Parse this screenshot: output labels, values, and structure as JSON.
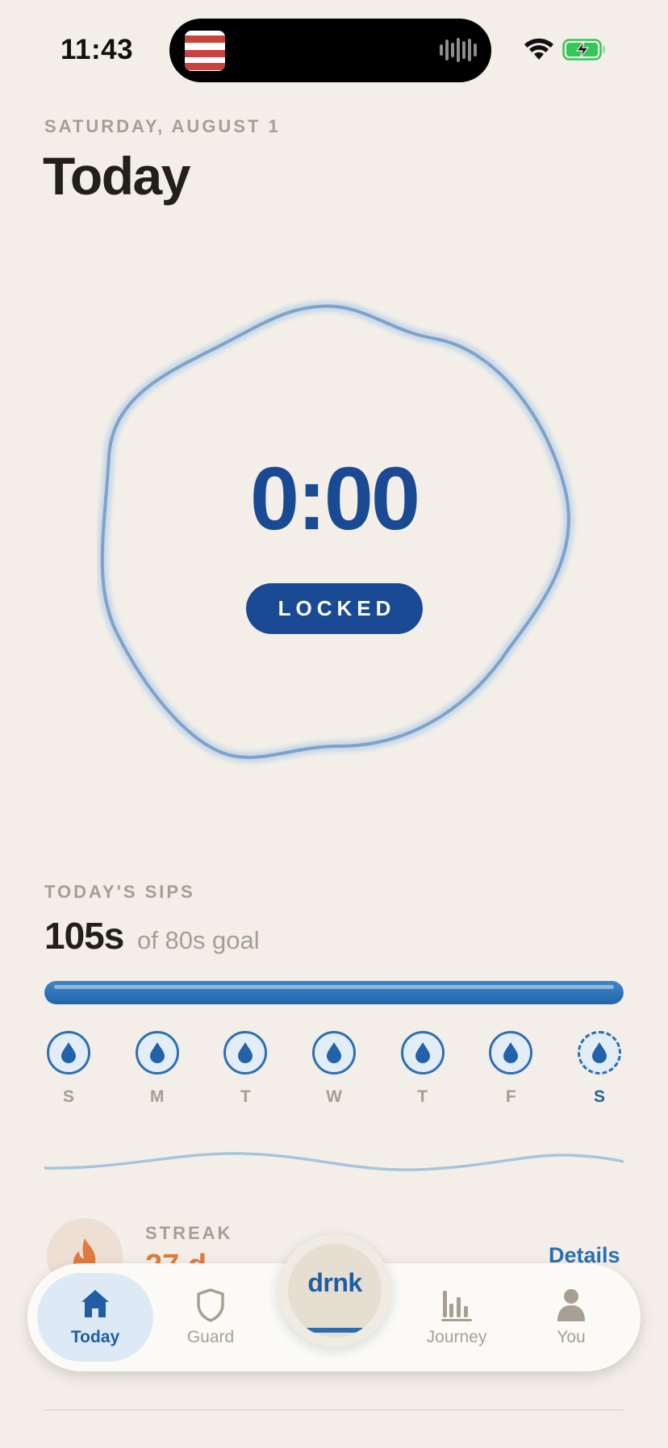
{
  "status_bar": {
    "time": "11:43",
    "icons": [
      "now-playing-art-icon",
      "audio-wave-icon",
      "wifi-icon",
      "battery-charging-icon"
    ]
  },
  "header": {
    "date": "SATURDAY, AUGUST 1",
    "title": "Today"
  },
  "timer": {
    "value": "0:00",
    "state_label": "LOCKED"
  },
  "sips": {
    "label": "TODAY'S SIPS",
    "value": "105s",
    "goal_text": "of 80s goal",
    "progress_fraction": 1.0,
    "days": [
      {
        "letter": "S",
        "today": false
      },
      {
        "letter": "M",
        "today": false
      },
      {
        "letter": "T",
        "today": false
      },
      {
        "letter": "W",
        "today": false
      },
      {
        "letter": "T",
        "today": false
      },
      {
        "letter": "F",
        "today": false
      },
      {
        "letter": "S",
        "today": true
      }
    ]
  },
  "streak": {
    "label": "STREAK",
    "value": "27 d",
    "details_label": "Details",
    "icon": "flame-icon"
  },
  "tab_bar": {
    "today": "Today",
    "guard": "Guard",
    "center_brand": "drnk",
    "journey": "Journey",
    "you": "You"
  },
  "colors": {
    "background": "#f3efe8",
    "accent_blue": "#1a4a94",
    "streak_orange": "#e07a3d",
    "muted_text": "#a59e93"
  }
}
